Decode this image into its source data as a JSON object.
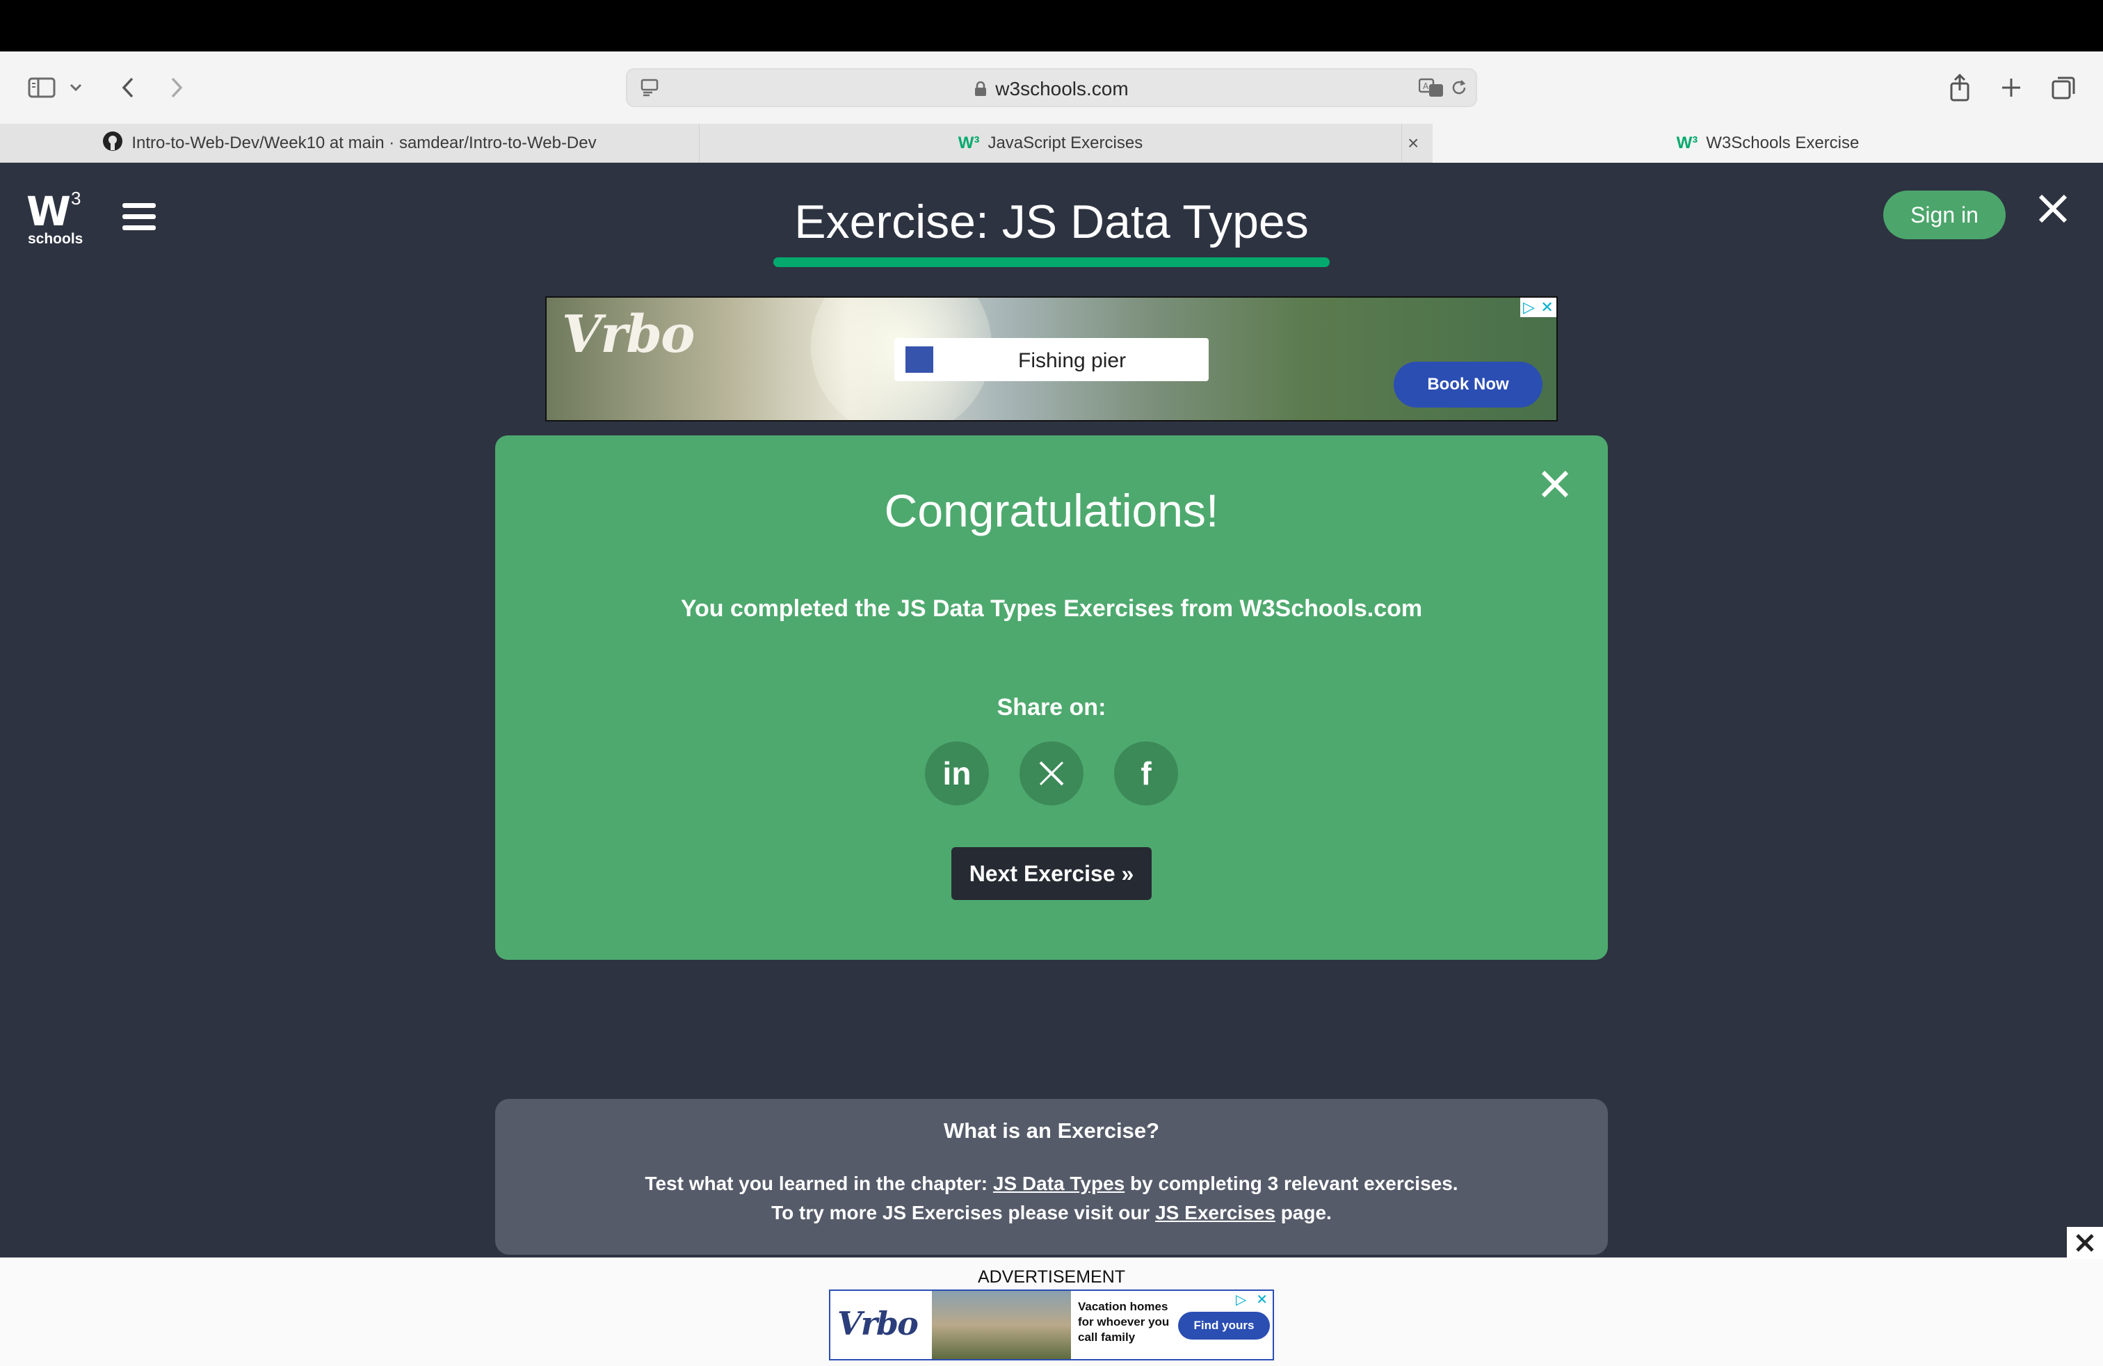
{
  "browser": {
    "url": "w3schools.com",
    "tabs": [
      {
        "label": "Intro-to-Web-Dev/Week10 at main · samdear/Intro-to-Web-Dev",
        "icon": "github-icon"
      },
      {
        "label": "JavaScript Exercises",
        "icon": "w3schools-icon"
      },
      {
        "label": "W3Schools Exercise",
        "icon": "w3schools-icon"
      }
    ]
  },
  "header": {
    "logo_main": "W",
    "logo_sup": "3",
    "logo_sub": "schools",
    "title": "Exercise: JS Data Types",
    "sign_in": "Sign in",
    "accent_color": "#04aa6d"
  },
  "ad_top": {
    "brand": "Vrbo",
    "search_text": "Fishing pier",
    "button": "Book Now"
  },
  "congrats": {
    "heading": "Congratulations!",
    "message": "You completed the JS Data Types Exercises from W3Schools.com",
    "share_label": "Share on:",
    "share_icons": [
      "linkedin-icon",
      "x-icon",
      "facebook-icon"
    ],
    "linkedin_text": "in",
    "facebook_text": "f",
    "next_button": "Next Exercise »",
    "panel_color": "#4ea96e"
  },
  "info": {
    "heading": "What is an Exercise?",
    "line1_before": "Test what you learned in the chapter:",
    "line1_link": "JS Data Types",
    "line1_after": "by completing 3 relevant exercises.",
    "line2_before": "To try more JS Exercises please visit our",
    "line2_link": "JS Exercises",
    "line2_after": "page."
  },
  "bottom_ad": {
    "label": "ADVERTISEMENT",
    "brand": "Vrbo",
    "text": "Vacation homes for whoever you call family",
    "button": "Find yours"
  }
}
